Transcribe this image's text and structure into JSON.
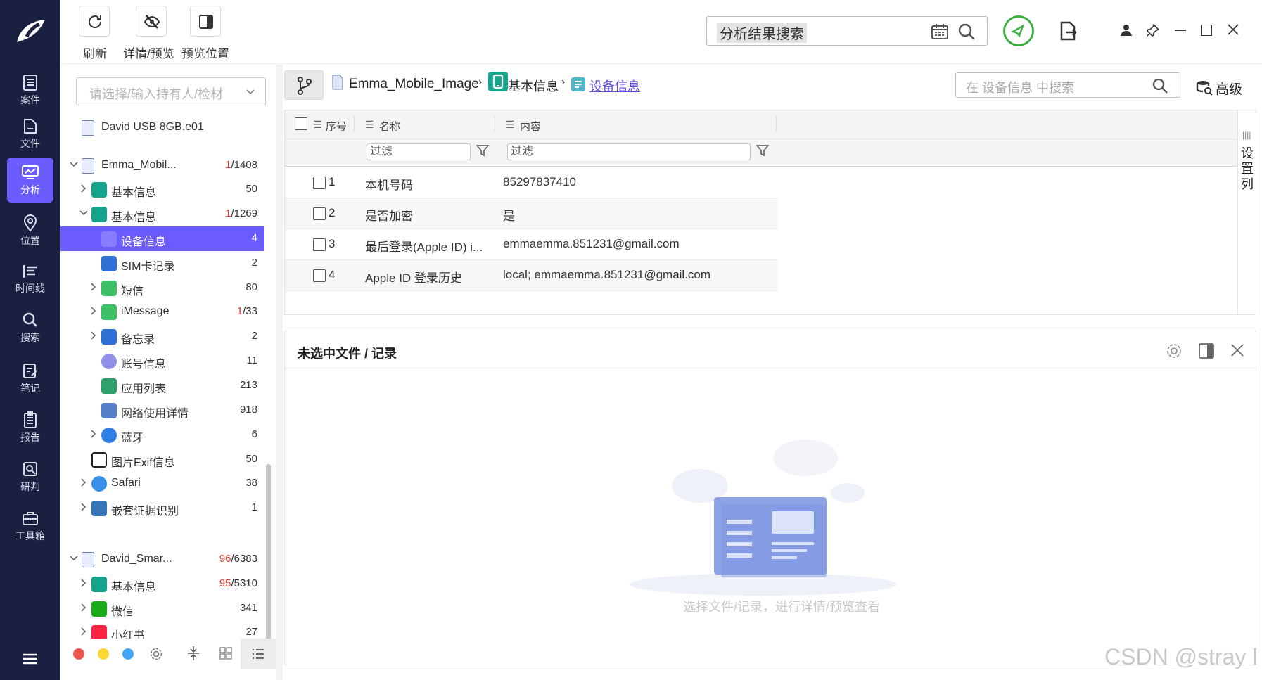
{
  "toolbar": {
    "refresh_label": "刷新",
    "detail_preview_label": "详情/预览",
    "preview_position_label": "预览位置"
  },
  "global_search": {
    "value": "分析结果搜索"
  },
  "nav": {
    "items": [
      {
        "label": "案件"
      },
      {
        "label": "文件"
      },
      {
        "label": "分析"
      },
      {
        "label": "位置"
      },
      {
        "label": "时间线"
      },
      {
        "label": "搜索"
      },
      {
        "label": "笔记"
      },
      {
        "label": "报告"
      },
      {
        "label": "研判"
      },
      {
        "label": "工具箱"
      }
    ]
  },
  "sidebar": {
    "select_placeholder": "请选择/输入持有人/检材",
    "tree": [
      {
        "label": "David USB 8GB.e01",
        "count": ""
      },
      {
        "label": "Emma_Mobil...",
        "count_red": "1",
        "count_rest": "/1408"
      },
      {
        "label": "基本信息",
        "count": "50"
      },
      {
        "label": "基本信息",
        "count_red": "1",
        "count_rest": "/1269"
      },
      {
        "label": "设备信息",
        "count": "4"
      },
      {
        "label": "SIM卡记录",
        "count": "2"
      },
      {
        "label": "短信",
        "count": "80"
      },
      {
        "label": "iMessage",
        "count_red": "1",
        "count_rest": "/33"
      },
      {
        "label": "备忘录",
        "count": "2"
      },
      {
        "label": "账号信息",
        "count": "11"
      },
      {
        "label": "应用列表",
        "count": "213"
      },
      {
        "label": "网络使用详情",
        "count": "918"
      },
      {
        "label": "蓝牙",
        "count": "6"
      },
      {
        "label": "图片Exif信息",
        "count": "50"
      },
      {
        "label": "Safari",
        "count": "38"
      },
      {
        "label": "嵌套证据识别",
        "count": "1"
      },
      {
        "label": "David_Smar...",
        "count_red": "96",
        "count_rest": "/6383"
      },
      {
        "label": "基本信息",
        "count_red": "95",
        "count_rest": "/5310"
      },
      {
        "label": "微信",
        "count": "341"
      },
      {
        "label": "小红书",
        "count": "27"
      }
    ]
  },
  "breadcrumb": {
    "items": [
      "Emma_Mobile_Image",
      "基本信息",
      "设备信息"
    ],
    "search_placeholder": "在 设备信息 中搜索",
    "advanced_label": "高级"
  },
  "grid": {
    "columns": [
      "序号",
      "名称",
      "内容"
    ],
    "filter_label": "过滤",
    "settings_columns_label": "设置列",
    "rows": [
      {
        "no": "1",
        "name": "本机号码",
        "content": "85297837410"
      },
      {
        "no": "2",
        "name": "是否加密",
        "content": "是"
      },
      {
        "no": "3",
        "name": "最后登录(Apple ID) i...",
        "content": "emmaemma.851231@gmail.com"
      },
      {
        "no": "4",
        "name": "Apple ID 登录历史",
        "content": "local; emmaemma.851231@gmail.com"
      }
    ]
  },
  "preview": {
    "title": "未选中文件 / 记录",
    "empty_hint": "选择文件/记录，进行详情/预览查看"
  },
  "watermark": "CSDN @stray l",
  "colors": {
    "accent": "#6b5cff",
    "nav_bg": "#1a2140",
    "green": "#3cb043"
  }
}
